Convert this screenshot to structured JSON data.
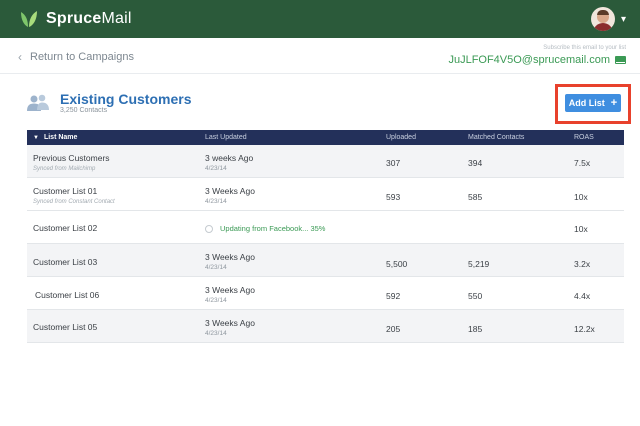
{
  "brand": {
    "name_bold": "Spruce",
    "name_light": "Mail"
  },
  "nav": {
    "back_label": "Return to Campaigns"
  },
  "subscribe": {
    "note": "Subscribe this email to your list",
    "email": "JuJLFOF4V5O@sprucemail.com"
  },
  "list": {
    "title": "Existing Customers",
    "count": "3,250 Contacts"
  },
  "actions": {
    "add_list_label": "Add List",
    "add_list_plus": "+"
  },
  "table": {
    "headers": [
      "List Name",
      "Last Updated",
      "Uploaded",
      "Matched Contacts",
      "ROAS"
    ],
    "rows": [
      {
        "name": "Previous Customers",
        "source": "Synced from Mailchimp",
        "updated": "3 weeks Ago",
        "date": "4/23/14",
        "uploaded": "307",
        "matched": "394",
        "roas": "7.5x"
      },
      {
        "name": "Customer List 01",
        "source": "Synced from Constant Contact",
        "updated": "3 Weeks Ago",
        "date": "4/23/14",
        "uploaded": "593",
        "matched": "585",
        "roas": "10x"
      },
      {
        "name": "Customer List 02",
        "source": "",
        "updated": "Updating from Facebook... 35%",
        "date": "",
        "uploaded": "",
        "matched": "",
        "roas": "10x"
      },
      {
        "name": "Customer List 03",
        "source": "",
        "updated": "3 Weeks Ago",
        "date": "4/23/14",
        "uploaded": "5,500",
        "matched": "5,219",
        "roas": "3.2x"
      },
      {
        "name": "Customer List 06",
        "source": "",
        "updated": "3 Weeks Ago",
        "date": "4/23/14",
        "uploaded": "592",
        "matched": "550",
        "roas": "4.4x"
      },
      {
        "name": "Customer List 05",
        "source": "",
        "updated": "3 Weeks Ago",
        "date": "4/23/14",
        "uploaded": "205",
        "matched": "185",
        "roas": "12.2x"
      }
    ]
  },
  "colors": {
    "header_bg": "#2b5a3a",
    "accent_blue": "#3f8ee0",
    "title_blue": "#2d6fb3",
    "green": "#3b9a55",
    "highlight": "#e8412c",
    "table_head": "#23305a"
  },
  "icons": {
    "logo": "leaf-logo-icon",
    "back": "chevron-left-icon",
    "mail": "mail-icon",
    "people": "people-icon",
    "menu": "chevron-down-icon"
  }
}
